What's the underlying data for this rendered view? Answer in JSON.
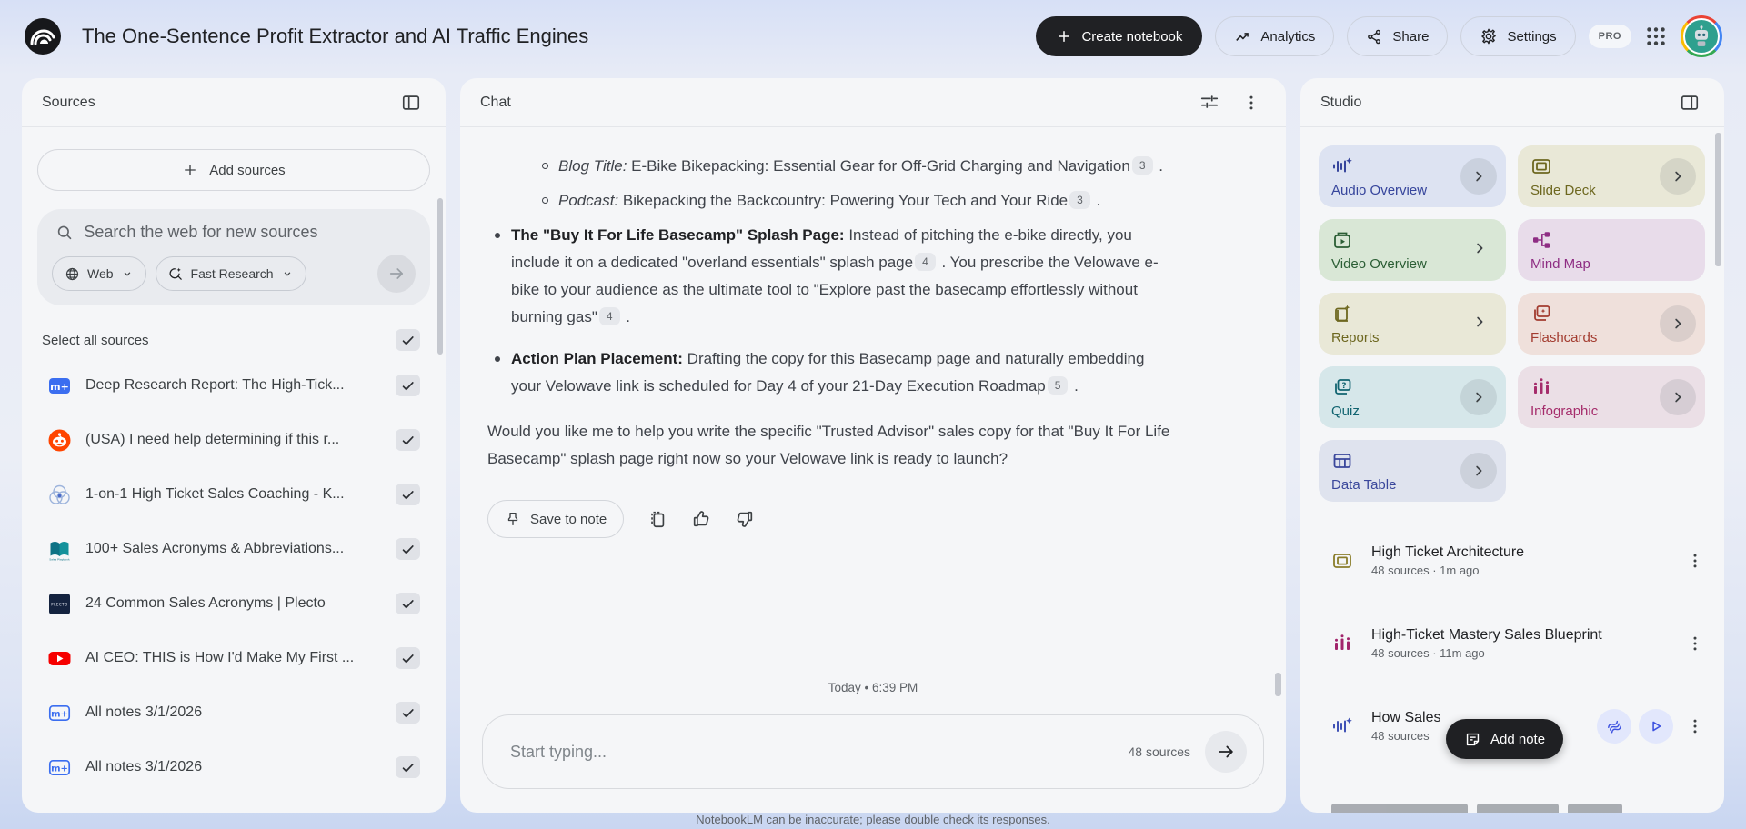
{
  "header": {
    "title": "The One-Sentence Profit Extractor and AI Traffic Engines",
    "create_notebook_label": "Create notebook",
    "analytics_label": "Analytics",
    "share_label": "Share",
    "settings_label": "Settings",
    "pro_badge": "PRO"
  },
  "sources": {
    "panel_title": "Sources",
    "add_sources_label": "Add sources",
    "search_placeholder": "Search the web for new sources",
    "web_chip_label": "Web",
    "research_chip_label": "Fast Research",
    "select_all_label": "Select all sources",
    "items": [
      {
        "icon": "note-filled-icon",
        "title": "Deep Research Report: The High-Tick...",
        "checked": true
      },
      {
        "icon": "reddit-icon",
        "title": "(USA) I need help determining if this r...",
        "checked": true
      },
      {
        "icon": "venn-icon",
        "title": "1-on-1 High Ticket Sales Coaching - K...",
        "checked": true
      },
      {
        "icon": "book-icon",
        "title": "100+ Sales Acronyms & Abbreviations...",
        "checked": true
      },
      {
        "icon": "plecto-icon",
        "title": "24 Common Sales Acronyms | Plecto",
        "checked": true
      },
      {
        "icon": "youtube-icon",
        "title": "AI CEO: THIS is How I'd Make My First ...",
        "checked": true
      },
      {
        "icon": "note-outline-icon",
        "title": "All notes 3/1/2026",
        "checked": true
      },
      {
        "icon": "note-outline-icon",
        "title": "All notes 3/1/2026",
        "checked": true
      }
    ]
  },
  "chat": {
    "panel_title": "Chat",
    "blocks": [
      {
        "kind": "sub",
        "segments": [
          {
            "t": "Blog Title:",
            "s": "i"
          },
          {
            "t": " E-Bike Bikepacking: Essential Gear for Off-Grid Charging and Navigation"
          },
          {
            "c": "3"
          },
          {
            "t": " ."
          }
        ]
      },
      {
        "kind": "sub",
        "segments": [
          {
            "t": "Podcast:",
            "s": "i"
          },
          {
            "t": " Bikepacking the Backcountry: Powering Your Tech and Your Ride"
          },
          {
            "c": "3"
          },
          {
            "t": " ."
          }
        ]
      },
      {
        "kind": "bullet",
        "segments": [
          {
            "t": "The \"Buy It For Life Basecamp\" Splash Page:",
            "s": "b"
          },
          {
            "t": " Instead of pitching the e-bike directly, you include it on a dedicated \"overland essentials\" splash page"
          },
          {
            "c": "4"
          },
          {
            "t": " . You prescribe the Velowave e-bike to your audience as the ultimate tool to \"Explore past the basecamp effortlessly without burning gas\""
          },
          {
            "c": "4"
          },
          {
            "t": " ."
          }
        ]
      },
      {
        "kind": "bullet",
        "segments": [
          {
            "t": "Action Plan Placement:",
            "s": "b"
          },
          {
            "t": " Drafting the copy for this Basecamp page and naturally embedding your Velowave link is scheduled for Day 4 of your 21-Day Execution Roadmap"
          },
          {
            "c": "5"
          },
          {
            "t": " ."
          }
        ]
      },
      {
        "kind": "para",
        "segments": [
          {
            "t": "Would you like me to help you write the specific \"Trusted Advisor\" sales copy for that \"Buy It For Life Basecamp\" splash page right now so your Velowave link is ready to launch?"
          }
        ]
      }
    ],
    "save_to_note_label": "Save to note",
    "timestamp": "Today • 6:39 PM",
    "input_placeholder": "Start typing...",
    "sources_count": "48 sources"
  },
  "studio": {
    "panel_title": "Studio",
    "tiles": [
      {
        "label": "Audio Overview",
        "icon": "audio-waveform-icon",
        "bg": "#dde3f2",
        "fg": "#36459c",
        "chevron": "circle"
      },
      {
        "label": "Slide Deck",
        "icon": "slide-deck-icon",
        "bg": "#e9e8d7",
        "fg": "#6d671f",
        "chevron": "circle"
      },
      {
        "label": "Video Overview",
        "icon": "video-overview-icon",
        "bg": "#d9e7d6",
        "fg": "#2b5e35",
        "chevron": "plain"
      },
      {
        "label": "Mind Map",
        "icon": "mind-map-icon",
        "bg": "#e8dcea",
        "fg": "#8e2d83",
        "chevron": "none"
      },
      {
        "label": "Reports",
        "icon": "reports-icon",
        "bg": "#e9e8d7",
        "fg": "#6d671f",
        "chevron": "plain"
      },
      {
        "label": "Flashcards",
        "icon": "flashcards-icon",
        "bg": "#efe0db",
        "fg": "#a33c30",
        "chevron": "circle"
      },
      {
        "label": "Quiz",
        "icon": "quiz-icon",
        "bg": "#d6e7ea",
        "fg": "#116470",
        "chevron": "circle"
      },
      {
        "label": "Infographic",
        "icon": "infographic-icon",
        "bg": "#ebdfe6",
        "fg": "#a52c6b",
        "chevron": "circle"
      },
      {
        "label": "Data Table",
        "icon": "data-table-icon",
        "bg": "#dfe3ee",
        "fg": "#3a479b",
        "chevron": "circle"
      }
    ],
    "items": [
      {
        "icon": "slide-deck-icon",
        "color": "#8a7d2a",
        "title": "High Ticket Architecture",
        "meta": "48 sources · 1m ago"
      },
      {
        "icon": "infographic-icon",
        "color": "#a1246b",
        "title": "High-Ticket Mastery Sales Blueprint",
        "meta": "48 sources · 11m ago"
      },
      {
        "icon": "audio-waveform-icon",
        "color": "#3f51b5",
        "title": "How Sales",
        "meta": "48 sources",
        "actions": true
      }
    ],
    "add_note_label": "Add note"
  },
  "footer": {
    "disclaimer": "NotebookLM can be inaccurate; please double check its responses."
  }
}
